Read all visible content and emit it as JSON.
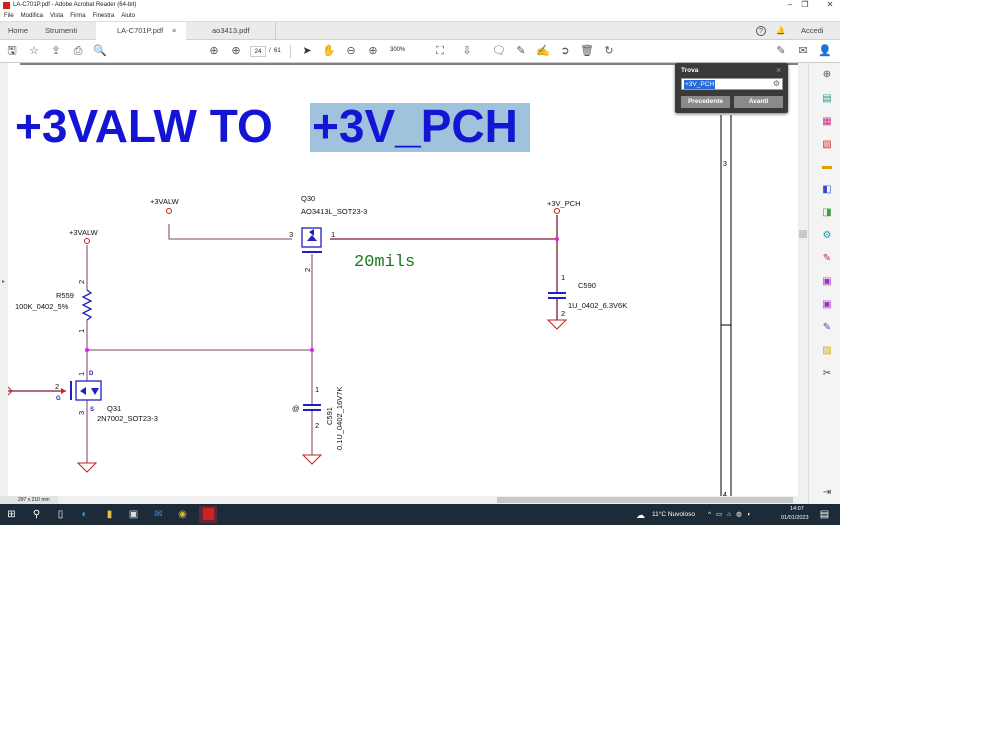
{
  "window": {
    "title": "LA-C701P.pdf - Adobe Acrobat Reader (64-bit)",
    "minimize": "–",
    "restore": "❐",
    "close": "✕"
  },
  "menu": [
    "File",
    "Modifica",
    "Vista",
    "Firma",
    "Finestra",
    "Aiuto"
  ],
  "tabs": {
    "home": "Home",
    "tools": "Strumenti",
    "doc1": "LA-C701P.pdf",
    "doc1_close": "×",
    "doc2": "ao3413.pdf",
    "help": "?",
    "signin": "Accedi"
  },
  "toolbar": {
    "page_current": "24",
    "page_sep": "/",
    "page_total": "61",
    "zoom": "300%"
  },
  "find": {
    "title": "Trova",
    "close": "×",
    "query": "+3V_PCH",
    "prev": "Precedente",
    "next": "Avanti"
  },
  "status": {
    "page_size": "297 x 210 mm"
  },
  "schematic": {
    "heading_a": "+3VALW TO",
    "heading_b": "+3V_PCH",
    "net_3valw": "+3VALW",
    "net_3v_pch": "+3V_PCH",
    "q30_ref": "Q30",
    "q30_val": "AO3413L_SOT23-3",
    "q31_ref": "Q31",
    "q31_val": "2N7002_SOT23-3",
    "r559_ref": "R559",
    "r559_val": "100K_0402_5%",
    "c590_ref": "C590",
    "c590_val": "1U_0402_6.3V6K",
    "c591_ref": "C591",
    "c591_val": "0.1U_0402_16V7K",
    "trace_note": "20mils",
    "pin1": "1",
    "pin2": "2",
    "pin3": "3",
    "pin_d": "D",
    "pin_g": "G",
    "pin_s": "S",
    "at": "@",
    "zone3": "3",
    "zone4": "4"
  },
  "taskbar": {
    "weather": "11°C  Nuvoloso",
    "time": "14:07",
    "date": "01/01/2023"
  },
  "colors": {
    "heading": "#1414d4",
    "highlight": "#9fc3dd",
    "wire": "#9a6a8a",
    "junction": "#e020e0",
    "component": "#2020c0",
    "note": "#1a7a1a"
  }
}
